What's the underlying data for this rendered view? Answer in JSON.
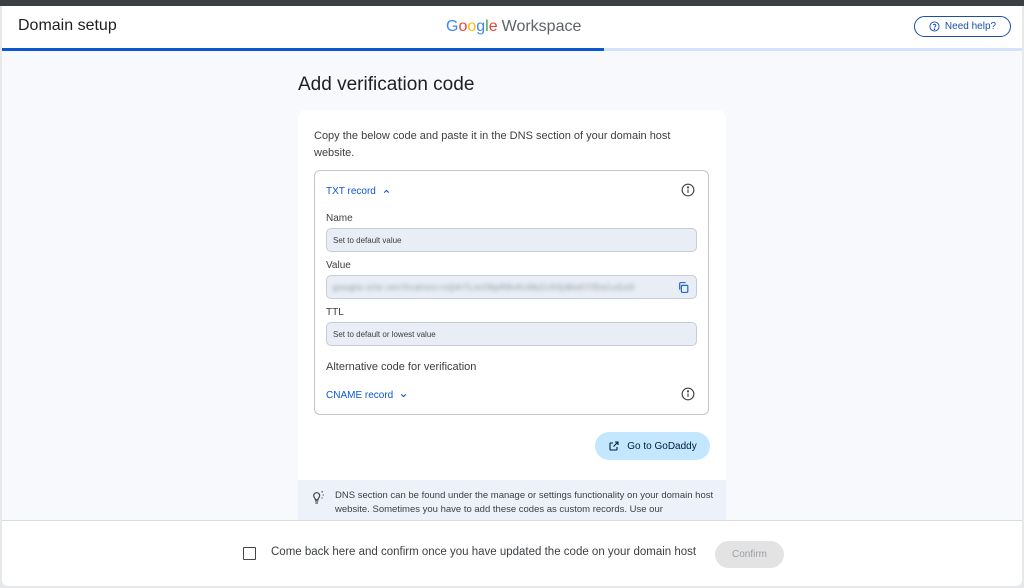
{
  "header": {
    "title": "Domain setup",
    "brand": {
      "g1": "G",
      "o1": "o",
      "o2": "o",
      "g2": "g",
      "l": "l",
      "e": "e",
      "product": "Workspace"
    },
    "help_label": "Need help?"
  },
  "progress": {
    "fraction": 0.59
  },
  "main": {
    "title": "Add verification code",
    "intro": "Copy the below code and paste it in the DNS section of your domain host website.",
    "txt_record": {
      "toggle_label": "TXT record",
      "expanded": true,
      "name_label": "Name",
      "name_value": "Set to default value",
      "value_label": "Value",
      "value_obscured": "google-site-verification=xQ4t7Lm2NpR8vKs9bZcH3jWe6YfDa1uGo0",
      "ttl_label": "TTL",
      "ttl_value": "Set to default or lowest value"
    },
    "alt_label": "Alternative code for verification",
    "cname_record": {
      "toggle_label": "CNAME record",
      "expanded": false
    },
    "go_button": "Go to GoDaddy",
    "tip": "DNS section can be found under the manage or settings functionality on your domain host website. Sometimes you have to add these codes as custom records. Use our"
  },
  "footer": {
    "confirm_text": "Come back here and confirm once you have updated the code on your domain host",
    "confirm_button": "Confirm",
    "checked": false
  },
  "colors": {
    "accent": "#0b57d0",
    "progress_track": "#d3e3fd",
    "go_button_bg": "#c2e7ff",
    "field_bg": "#e9eef6",
    "tip_bg": "#edf2fa"
  },
  "icons": {
    "help": "help-circle-icon",
    "txt_toggle": "chevron-up-icon",
    "cname_toggle": "chevron-down-icon",
    "info": "info-icon",
    "copy": "copy-icon",
    "external": "open-in-new-icon",
    "tip": "lightbulb-icon"
  }
}
